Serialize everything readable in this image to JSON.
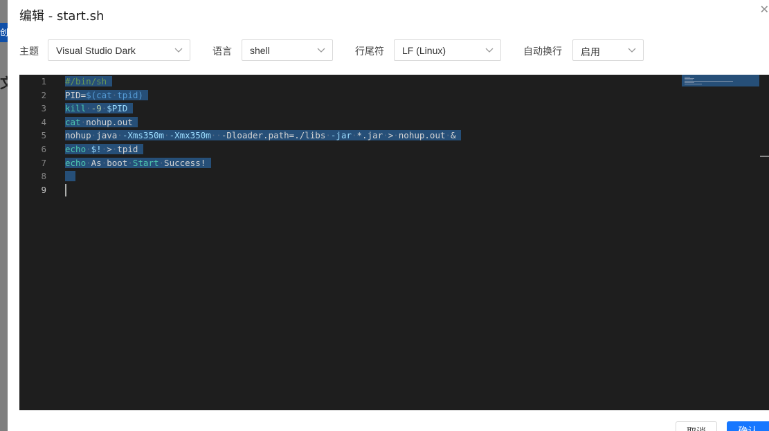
{
  "background": {
    "button_fragment": "创",
    "heading_fragment": "文"
  },
  "dialog": {
    "title": "编辑 - start.sh",
    "close_icon": "close-icon",
    "toolbar": {
      "theme_label": "主题",
      "theme_value": "Visual Studio Dark",
      "language_label": "语言",
      "language_value": "shell",
      "eol_label": "行尾符",
      "eol_value": "LF (Linux)",
      "wrap_label": "自动换行",
      "wrap_value": "启用"
    },
    "editor": {
      "line_numbers": [
        "1",
        "2",
        "3",
        "4",
        "5",
        "6",
        "7",
        "8",
        "9"
      ],
      "active_line": 9,
      "lines": [
        "#/bin/sh",
        "PID=$(cat tpid)",
        "kill -9 $PID",
        "cat nohup.out",
        "nohup java -Xms350m -Xmx350m  -Dloader.path=./libs -jar *.jar > nohup.out &",
        "echo $! > tpid",
        "echo As boot Start Success!",
        "",
        ""
      ]
    },
    "footer": {
      "cancel_label": "取消",
      "ok_label": "确认"
    }
  },
  "colors": {
    "editor_bg": "#1e1e1e",
    "selection": "#264f78",
    "primary": "#1677ff"
  }
}
